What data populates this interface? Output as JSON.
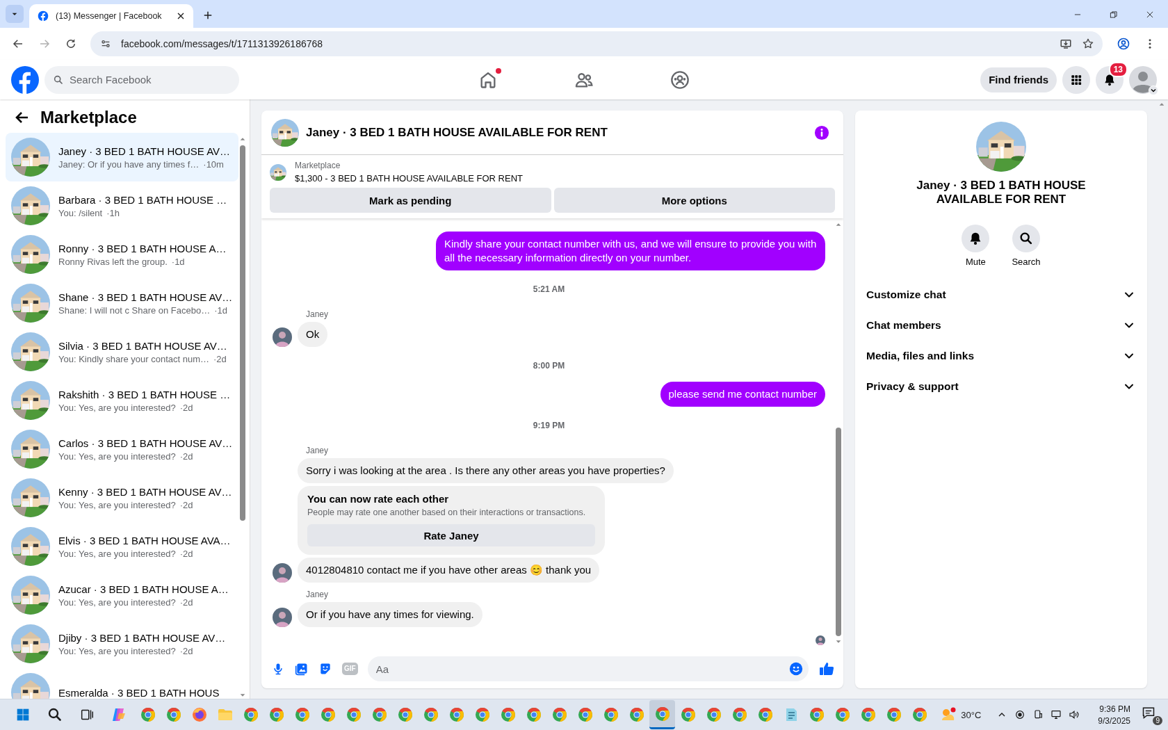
{
  "browser": {
    "tab_title": "(13) Messenger | Facebook",
    "url": "facebook.com/messages/t/1711313926186768"
  },
  "header": {
    "search_placeholder": "Search Facebook",
    "nav": [
      {
        "kind": "home",
        "dot": true
      },
      {
        "kind": "friends",
        "dot": false
      },
      {
        "kind": "groups",
        "dot": false
      }
    ],
    "find_friends": "Find friends",
    "notifications_badge": "13"
  },
  "sidebar": {
    "title": "Marketplace",
    "conversations": [
      {
        "title": "Janey · 3 BED 1 BATH HOUSE AV…",
        "preview": "Janey: Or if you have any times f…",
        "time": "·10m",
        "selected": true
      },
      {
        "title": "Barbara · 3 BED 1 BATH HOUSE …",
        "preview": "You: /silent",
        "time": "·1h",
        "selected": false
      },
      {
        "title": "Ronny · 3 BED 1 BATH HOUSE A…",
        "preview": "Ronny Rivas left the group.",
        "time": "·1d",
        "selected": false
      },
      {
        "title": "Shane · 3 BED 1 BATH HOUSE AV…",
        "preview": "Shane: I will not c Share on Facebo…",
        "time": "·1d",
        "selected": false
      },
      {
        "title": "Silvia · 3 BED 1 BATH HOUSE AV…",
        "preview": "You: Kindly share your contact num…",
        "time": "·2d",
        "selected": false
      },
      {
        "title": "Rakshith · 3 BED 1 BATH HOUSE …",
        "preview": "You: Yes, are you interested?",
        "time": "·2d",
        "selected": false
      },
      {
        "title": "Carlos · 3 BED 1 BATH HOUSE AV…",
        "preview": "You: Yes, are you interested?",
        "time": "·2d",
        "selected": false
      },
      {
        "title": "Kenny · 3 BED 1 BATH HOUSE AV…",
        "preview": "You: Yes, are you interested?",
        "time": "·2d",
        "selected": false
      },
      {
        "title": "Elvis · 3 BED 1 BATH HOUSE AVA…",
        "preview": "You: Yes, are you interested?",
        "time": "·2d",
        "selected": false
      },
      {
        "title": "Azucar · 3 BED 1 BATH HOUSE A…",
        "preview": "You: Yes, are you interested?",
        "time": "·2d",
        "selected": false
      },
      {
        "title": "Djiby · 3 BED 1 BATH HOUSE AV…",
        "preview": "You: Yes, are you interested?",
        "time": "·2d",
        "selected": false
      },
      {
        "title": "Esmeralda · 3 BED 1 BATH HOUS"
      }
    ]
  },
  "chat": {
    "title": "Janey · 3 BED 1 BATH HOUSE AVAILABLE FOR RENT",
    "listing": {
      "label": "Marketplace",
      "text": "$1,300 - 3 BED 1 BATH HOUSE AVAILABLE FOR RENT"
    },
    "buttons": [
      "Mark as pending",
      "More options"
    ],
    "messages": [
      {
        "kind": "outgoing",
        "text": "Kindly share your contact number with us, and we will ensure to provide you with all the necessary information directly on your number."
      },
      {
        "kind": "time",
        "text": "5:21 AM"
      },
      {
        "kind": "incoming",
        "sender": "Janey",
        "text": "Ok",
        "avatar": true
      },
      {
        "kind": "time",
        "text": "8:00 PM"
      },
      {
        "kind": "outgoing",
        "text": "please send me contact number"
      },
      {
        "kind": "time",
        "text": "9:19 PM"
      },
      {
        "kind": "incoming",
        "sender": "Janey",
        "text": "Sorry i was looking at the area . Is there any other areas you have properties?",
        "avatar": false
      },
      {
        "kind": "rating",
        "title": "You can now rate each other",
        "body": "People may rate one another based on their interactions or transactions.",
        "button": "Rate Janey",
        "avatar": false
      },
      {
        "kind": "incoming",
        "text": "4012804810 contact me if you have other areas 😊 thank you",
        "avatar": true
      },
      {
        "kind": "incoming",
        "sender": "Janey",
        "text": "Or if you have any times for viewing.",
        "avatar": true
      }
    ],
    "seen": true,
    "composer": {
      "gif_label": "GIF",
      "placeholder": "Aa"
    }
  },
  "info": {
    "title": "Janey · 3 BED 1 BATH HOUSE AVAILABLE FOR RENT",
    "actions": [
      {
        "kind": "mute",
        "label": "Mute"
      },
      {
        "kind": "search",
        "label": "Search"
      }
    ],
    "sections": [
      {
        "label": "Customize chat",
        "expanded": false
      },
      {
        "label": "Chat members",
        "expanded": false
      },
      {
        "label": "Media, files and links",
        "expanded": false
      },
      {
        "label": "Privacy & support",
        "expanded": false
      }
    ]
  },
  "taskbar": {
    "apps": [
      {
        "kind": "browser",
        "selected": false
      },
      {
        "kind": "browser",
        "selected": false
      },
      {
        "kind": "firefox",
        "selected": false
      },
      {
        "kind": "folder",
        "selected": false
      },
      {
        "kind": "browser",
        "selected": false
      },
      {
        "kind": "browser",
        "selected": false
      },
      {
        "kind": "browser",
        "selected": false
      },
      {
        "kind": "browser",
        "selected": false
      },
      {
        "kind": "browser",
        "selected": false
      },
      {
        "kind": "browser",
        "selected": false
      },
      {
        "kind": "browser",
        "selected": false
      },
      {
        "kind": "browser",
        "selected": false
      },
      {
        "kind": "browser",
        "selected": false
      },
      {
        "kind": "browser",
        "selected": false
      },
      {
        "kind": "browser",
        "selected": false
      },
      {
        "kind": "browser",
        "selected": false
      },
      {
        "kind": "browser",
        "selected": false
      },
      {
        "kind": "browser",
        "selected": false
      },
      {
        "kind": "browser",
        "selected": false
      },
      {
        "kind": "browser",
        "selected": false
      },
      {
        "kind": "browser",
        "selected": true
      },
      {
        "kind": "browser",
        "selected": false
      },
      {
        "kind": "browser",
        "selected": false
      },
      {
        "kind": "browser",
        "selected": false
      },
      {
        "kind": "browser",
        "selected": false
      },
      {
        "kind": "notes",
        "selected": false
      },
      {
        "kind": "browser",
        "selected": false
      },
      {
        "kind": "browser",
        "selected": false
      },
      {
        "kind": "browser",
        "selected": false
      },
      {
        "kind": "browser",
        "selected": false
      },
      {
        "kind": "browser",
        "selected": false
      }
    ],
    "temperature": "30°C",
    "time": "9:36 PM",
    "date": "9/3/2025",
    "notification_count": "9"
  }
}
